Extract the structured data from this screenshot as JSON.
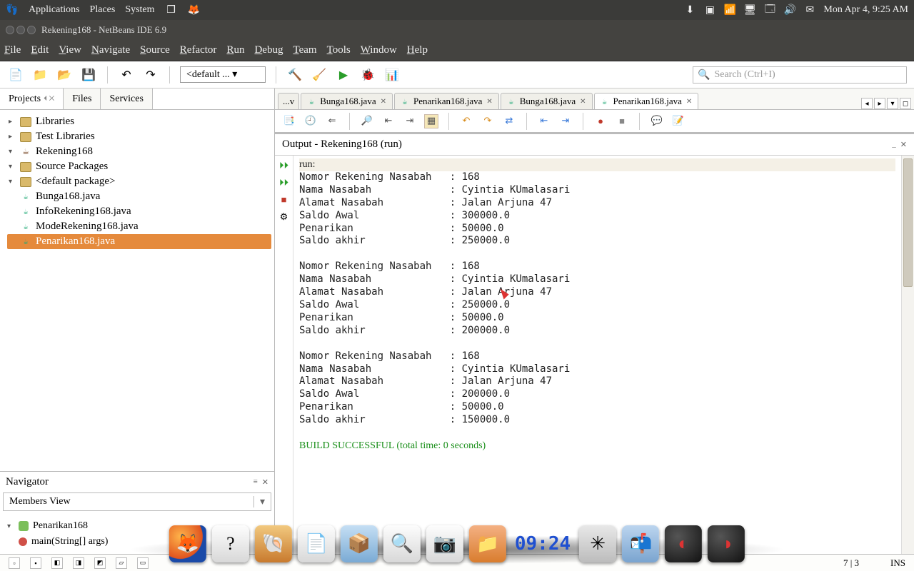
{
  "gnome": {
    "apps": "Applications",
    "places": "Places",
    "system": "System",
    "datetime": "Mon Apr  4,  9:25 AM"
  },
  "window": {
    "title": "Rekening168 - NetBeans IDE 6.9"
  },
  "menu": [
    "File",
    "Edit",
    "View",
    "Navigate",
    "Source",
    "Refactor",
    "Run",
    "Debug",
    "Team",
    "Tools",
    "Window",
    "Help"
  ],
  "toolbar": {
    "config": "<default ...",
    "search_placeholder": "Search (Ctrl+I)"
  },
  "sidetabs": [
    "Projects",
    "Files",
    "Services"
  ],
  "project_tree": {
    "libraries": "Libraries",
    "test_libraries": "Test Libraries",
    "project": "Rekening168",
    "src_packages": "Source Packages",
    "default_pkg": "<default package>",
    "files": [
      "Bunga168.java",
      "InfoRekening168.java",
      "ModeRekening168.java",
      "Penarikan168.java"
    ],
    "selected": "Penarikan168.java"
  },
  "navigator": {
    "title": "Navigator",
    "view": "Members View",
    "class": "Penarikan168",
    "method": "main(String[] args)"
  },
  "editor_tabs": {
    "overflow": "...v",
    "tabs": [
      "Bunga168.java",
      "Penarikan168.java",
      "Bunga168.java",
      "Penarikan168.java"
    ],
    "active_index": 3
  },
  "output": {
    "title": "Output  -  Rekening168 (run)",
    "run_label": "run:",
    "blocks": [
      {
        "nomor": "168",
        "nama": "Cyintia KUmalasari",
        "alamat": "Jalan Arjuna 47",
        "saldo_awal": "300000.0",
        "penarikan": "50000.0",
        "saldo_akhir": "250000.0"
      },
      {
        "nomor": "168",
        "nama": "Cyintia KUmalasari",
        "alamat": "Jalan Arjuna 47",
        "saldo_awal": "250000.0",
        "penarikan": "50000.0",
        "saldo_akhir": "200000.0"
      },
      {
        "nomor": "168",
        "nama": "Cyintia KUmalasari",
        "alamat": "Jalan Arjuna 47",
        "saldo_awal": "200000.0",
        "penarikan": "50000.0",
        "saldo_akhir": "150000.0"
      }
    ],
    "labels": {
      "nomor": "Nomor Rekening Nasabah",
      "nama": "Nama Nasabah",
      "alamat": "Alamat Nasabah",
      "saldo_awal": "Saldo Awal",
      "penarikan": "Penarikan",
      "saldo_akhir": "Saldo akhir"
    },
    "build": "BUILD SUCCESSFUL (total time: 0 seconds)"
  },
  "status": {
    "pos": "7 | 3",
    "mode": "INS"
  },
  "dock_clock": "09:24"
}
